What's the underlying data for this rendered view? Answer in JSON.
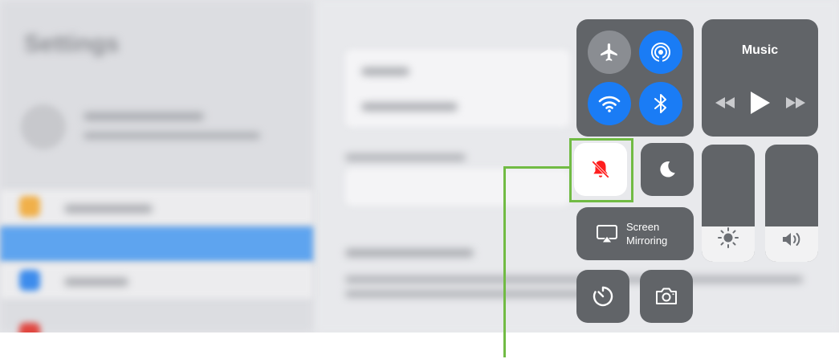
{
  "background": {
    "title": "Settings"
  },
  "control_center": {
    "connectivity": {
      "airplane_icon": "airplane-icon",
      "airdrop_icon": "airdrop-icon",
      "wifi_icon": "wifi-icon",
      "bluetooth_icon": "bluetooth-icon"
    },
    "music": {
      "title": "Music"
    },
    "mute_button": {
      "icon": "bell-slash-icon",
      "color": "#ff1e1e"
    },
    "dnd_button": {
      "icon": "moon-icon"
    },
    "screen_mirroring": {
      "line1": "Screen",
      "line2": "Mirroring"
    },
    "brightness_level": 0.3,
    "volume_level": 0.3,
    "timer_button": {
      "icon": "timer-icon"
    },
    "camera_button": {
      "icon": "camera-icon"
    }
  },
  "colors": {
    "accent_blue": "#1a7cf5",
    "tile_gray": "#616468",
    "highlight_green": "#71bb44"
  }
}
